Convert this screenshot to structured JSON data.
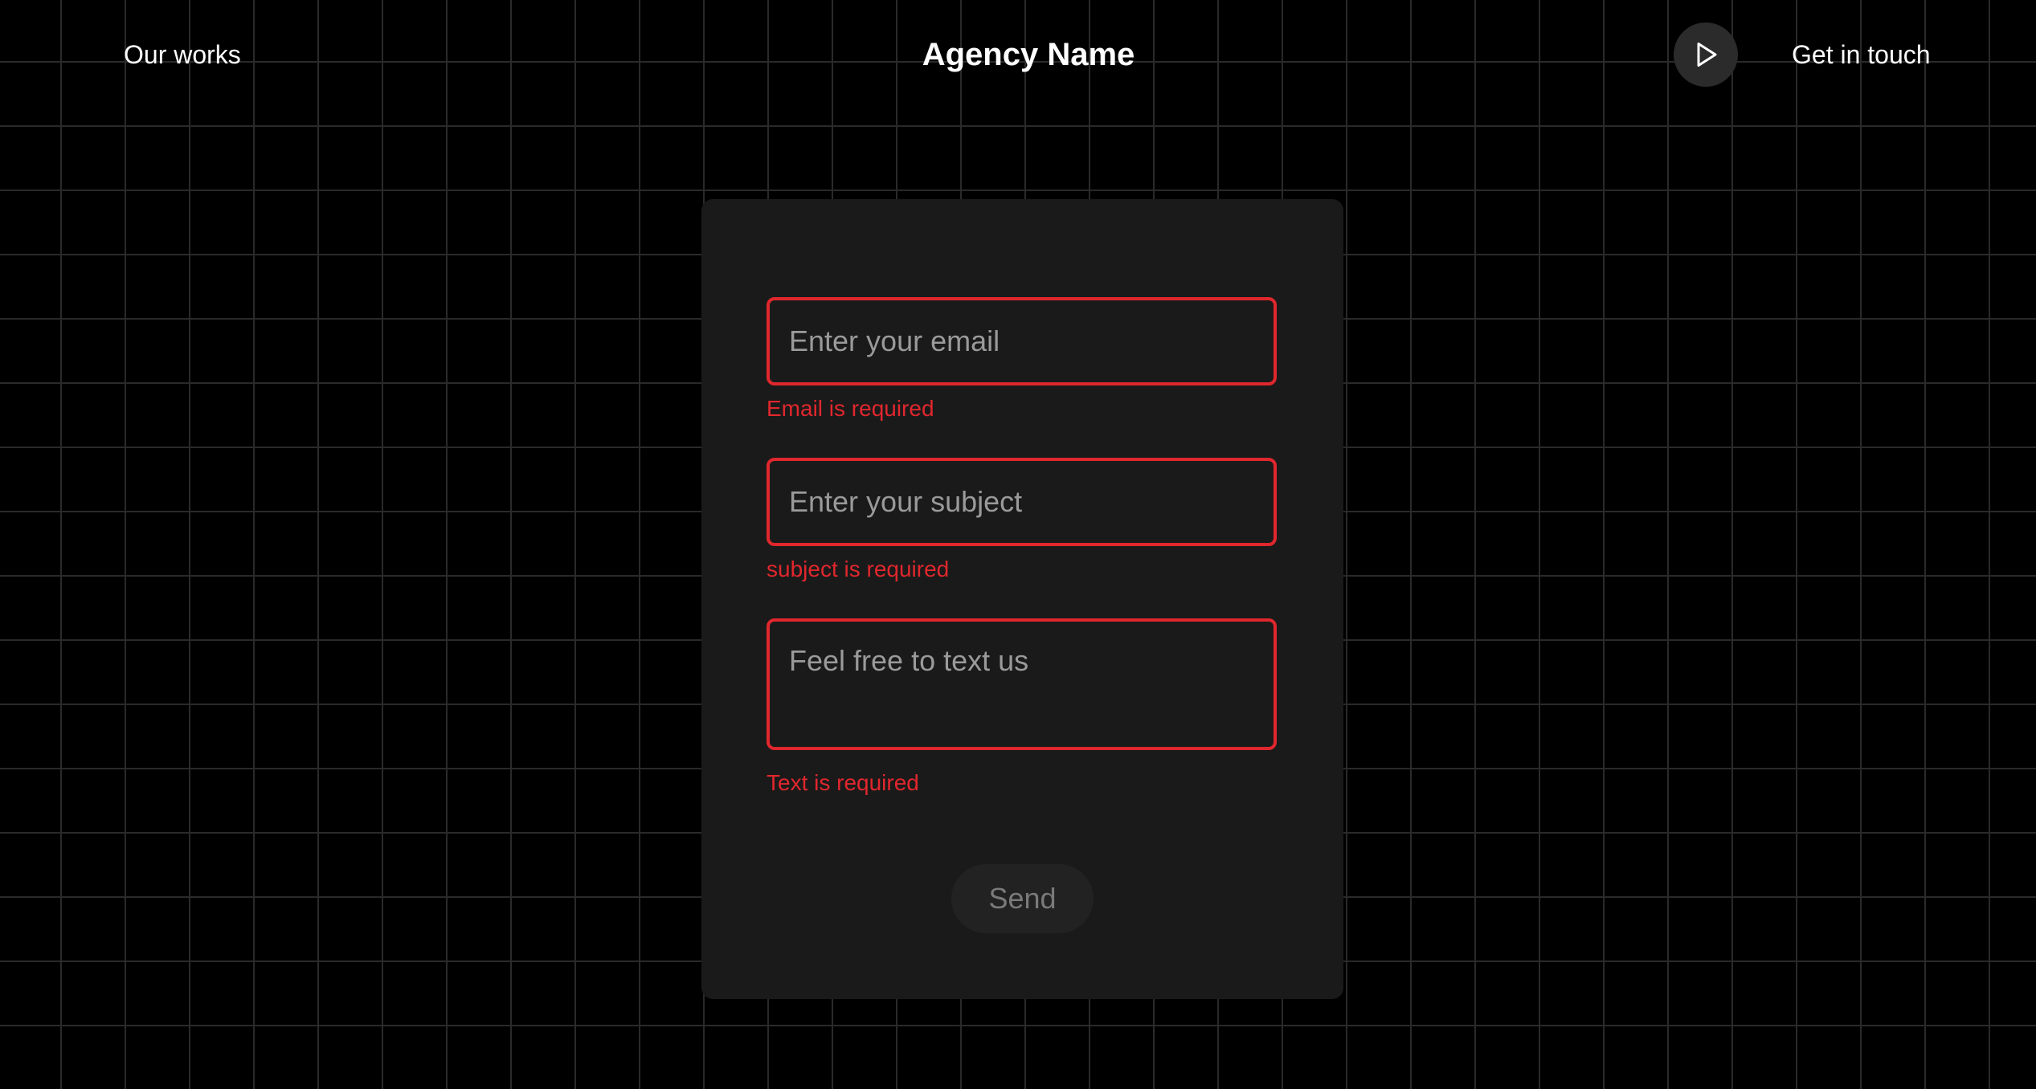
{
  "header": {
    "left_link": "Our works",
    "brand": "Agency Name",
    "play_icon": "play-icon",
    "right_link": "Get in touch"
  },
  "form": {
    "email": {
      "value": "",
      "placeholder": "Enter your email",
      "error": "Email is required"
    },
    "subject": {
      "value": "",
      "placeholder": "Enter your subject",
      "error": "subject is required"
    },
    "message": {
      "value": "",
      "placeholder": "Feel free to text us",
      "error": "Text is required"
    },
    "send_label": "Send"
  },
  "colors": {
    "background": "#000000",
    "grid_line": "#2a2a2a",
    "card": "#1a1a1a",
    "error": "#e0272d",
    "placeholder": "#9a9a9a",
    "send_button_bg": "#222222",
    "send_button_text": "#7a7a7a",
    "play_button_bg": "#2b2b2b"
  }
}
